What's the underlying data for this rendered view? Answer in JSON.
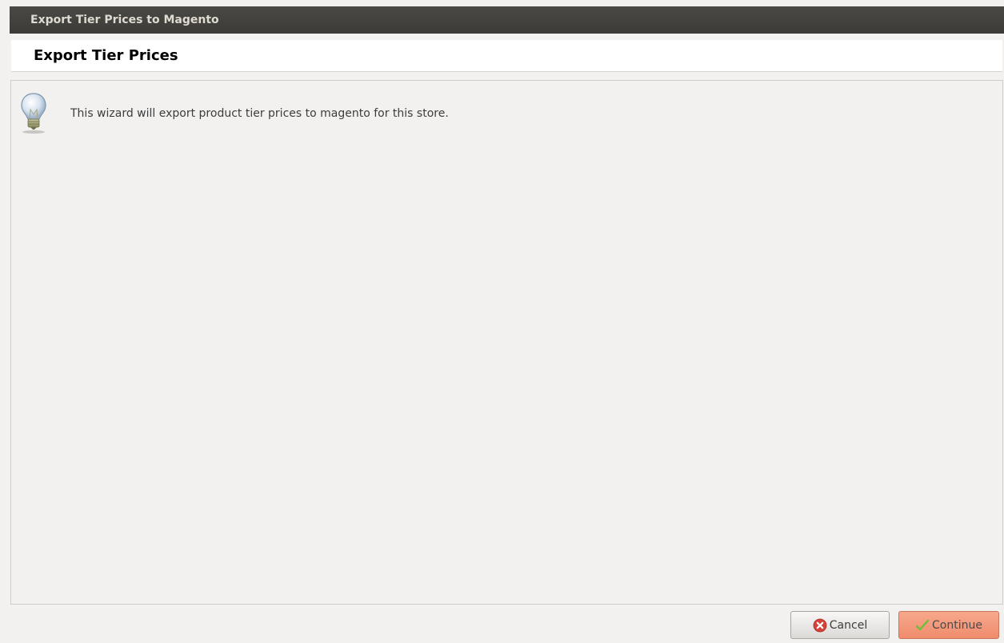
{
  "window": {
    "title": "Export Tier Prices to Magento"
  },
  "header": {
    "title": "Export Tier Prices"
  },
  "content": {
    "icon": "lightbulb-icon",
    "message": "This wizard will export product tier prices to magento for this store."
  },
  "buttons": {
    "cancel": {
      "label": "Cancel",
      "icon": "cancel-x-icon",
      "color": "#d8403a"
    },
    "continue": {
      "label": "Continue",
      "icon": "checkmark-icon",
      "color": "#f0906f"
    }
  }
}
